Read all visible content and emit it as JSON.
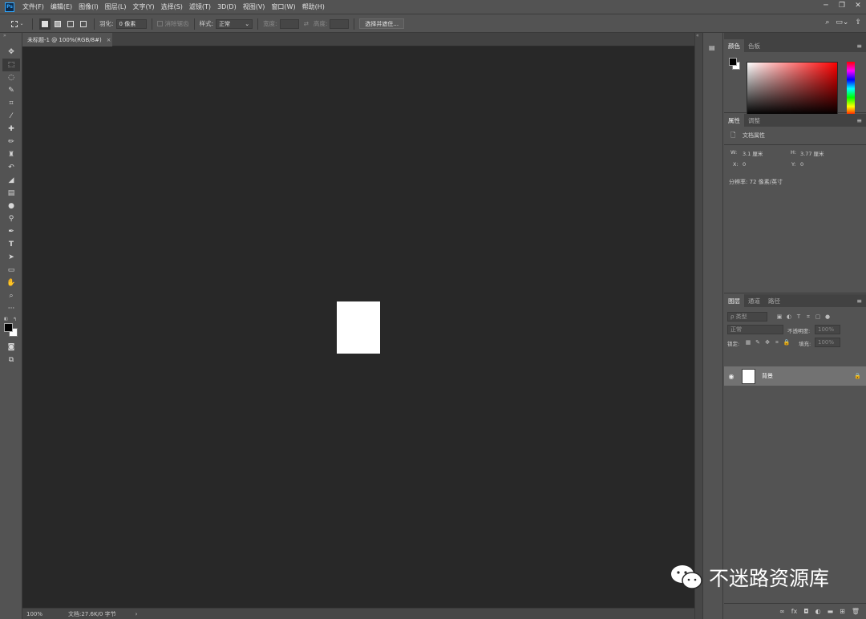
{
  "app": {
    "logo": "Ps"
  },
  "menu": [
    "文件(F)",
    "编辑(E)",
    "图像(I)",
    "图层(L)",
    "文字(Y)",
    "选择(S)",
    "滤镜(T)",
    "3D(D)",
    "视图(V)",
    "窗口(W)",
    "帮助(H)"
  ],
  "options": {
    "feather_label": "羽化:",
    "feather_value": "0 像素",
    "antialias_label": "消除锯齿",
    "style_label": "样式:",
    "style_value": "正常",
    "width_label": "宽度:",
    "height_label": "高度:",
    "select_mask": "选择并遮住..."
  },
  "doc": {
    "tab_title": "未标题-1 @ 100%(RGB/8#)",
    "zoom": "100%",
    "file_info": "文档:27.6K/0 字节"
  },
  "panels": {
    "color": {
      "tabs": [
        "颜色",
        "色板"
      ]
    },
    "properties": {
      "tabs": [
        "属性",
        "调整"
      ],
      "doc_label": "文档属性",
      "w_label": "W:",
      "w_value": "3.1 厘米",
      "h_label": "H:",
      "h_value": "3.77 厘米",
      "x_label": "X:",
      "x_value": "0",
      "y_label": "Y:",
      "y_value": "0",
      "resolution": "分辨率: 72 像素/英寸"
    },
    "layers": {
      "tabs": [
        "图层",
        "通道",
        "路径"
      ],
      "kind_placeholder": "ρ 类型",
      "blend": "正常",
      "opacity_label": "不透明度:",
      "opacity_value": "100%",
      "lock_label": "锁定:",
      "fill_label": "填充:",
      "fill_value": "100%",
      "layer_name": "背景"
    }
  },
  "watermark": "不迷路资源库",
  "colors": {
    "canvas": "#282828",
    "panel": "#535353",
    "accent": "#31a8ff"
  }
}
